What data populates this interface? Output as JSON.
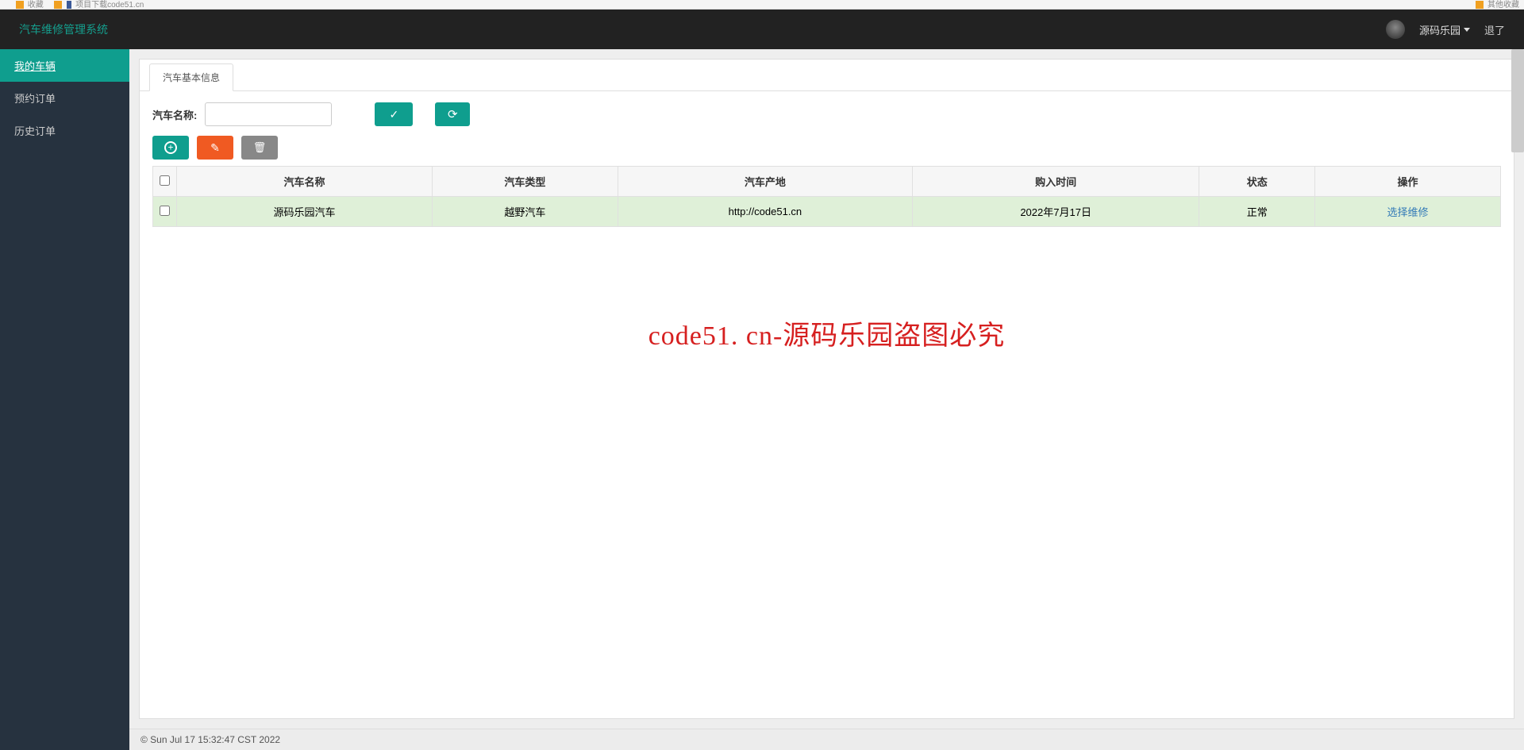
{
  "browser": {
    "tab_frag": "收藏",
    "title_frag": "项目下载code51.cn",
    "right_frag": "其他收藏"
  },
  "header": {
    "app_title": "汽车维修管理系统",
    "username": "源码乐园",
    "logout": "退了"
  },
  "sidebar": {
    "items": [
      {
        "label": "我的车辆",
        "active": true
      },
      {
        "label": "预约订单",
        "active": false
      },
      {
        "label": "历史订单",
        "active": false
      }
    ]
  },
  "tab": {
    "label": "汽车基本信息"
  },
  "toolbar": {
    "search_label": "汽车名称:",
    "search_value": ""
  },
  "table": {
    "headers": [
      "汽车名称",
      "汽车类型",
      "汽车产地",
      "购入时间",
      "状态",
      "操作"
    ],
    "rows": [
      {
        "name": "源码乐园汽车",
        "type": "越野汽车",
        "origin": "http://code51.cn",
        "buy_time": "2022年7月17日",
        "status": "正常",
        "action": "选择维修"
      }
    ]
  },
  "watermark": "code51. cn-源码乐园盗图必究",
  "footer": "© Sun Jul 17 15:32:47 CST 2022"
}
